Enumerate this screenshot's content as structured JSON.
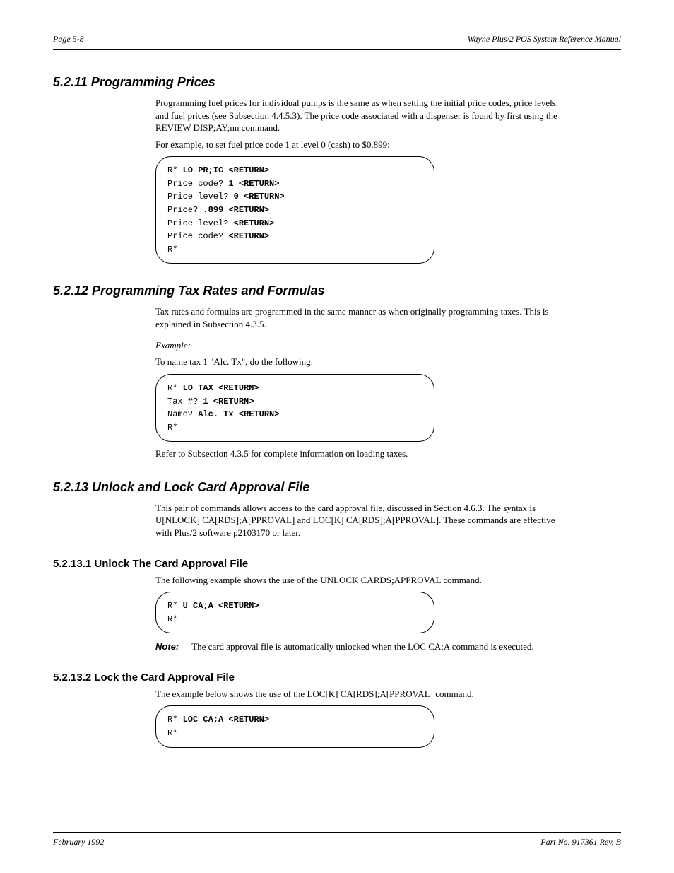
{
  "header": {
    "page_label": "Page 5-8",
    "title": "Wayne Plus/2 POS System Reference Manual"
  },
  "section1": {
    "heading": "5.2.11   Programming Prices",
    "para1": "Programming fuel prices for individual pumps is the same as when setting the initial price codes, price levels, and fuel prices (see Subsection 4.4.5.3). The price code associated with a dispenser is found by first using the REVIEW DISP;AY;nn command.",
    "para2": "For example, to set fuel price code 1 at level 0 (cash) to $0.899:",
    "terminal_lines": [
      {
        "prompt": "R* ",
        "input": "LO PR;IC <RETURN>"
      },
      {
        "prompt": "Price code? ",
        "input": "1 <RETURN>"
      },
      {
        "prompt": "Price level? ",
        "input": "0 <RETURN>"
      },
      {
        "prompt": "Price? ",
        "input": ".899 <RETURN>"
      },
      {
        "prompt": "Price level? ",
        "input": "<RETURN>"
      },
      {
        "prompt": "Price code? ",
        "input": "<RETURN>"
      },
      {
        "prompt": "R*",
        "input": ""
      }
    ]
  },
  "section2": {
    "heading": "5.2.12   Programming Tax Rates and Formulas",
    "para1": "Tax rates and formulas are programmed in the same manner as when originally programming taxes. This is explained in Subsection 4.3.5.",
    "example_label": "Example:",
    "para2": "To name tax 1 \"Alc. Tx\", do the following:",
    "terminal_lines": [
      {
        "prompt": "R* ",
        "input": "LO TAX <RETURN>"
      },
      {
        "prompt": "Tax #? ",
        "input": "1 <RETURN>"
      },
      {
        "prompt": "Name? ",
        "input": "Alc. Tx <RETURN>"
      },
      {
        "prompt": "R*",
        "input": ""
      }
    ],
    "para3": "Refer to Subsection 4.3.5 for complete information on loading taxes."
  },
  "section3": {
    "heading": "5.2.13   Unlock and Lock Card Approval File",
    "para1": "This pair of commands allows access to the card approval file, discussed in Section 4.6.3. The syntax is U[NLOCK] CA[RDS];A[PPROVAL] and LOC[K] CA[RDS];A[PPROVAL]. These commands are effective with Plus/2 software p2103170 or later.",
    "sub1": {
      "heading": "5.2.13.1   Unlock The Card Approval File",
      "para": "The following example shows the use of the UNLOCK CARDS;APPROVAL command.",
      "terminal_lines": [
        {
          "prompt": "R* ",
          "input": "U CA;A <RETURN>"
        },
        {
          "prompt": "R*",
          "input": ""
        }
      ],
      "note": "The card approval file is automatically unlocked when the LOC CA;A command is executed."
    },
    "sub2": {
      "heading": "5.2.13.2   Lock the Card Approval File",
      "para": "The example below shows the use of the LOC[K] CA[RDS];A[PPROVAL] command.",
      "terminal_lines": [
        {
          "prompt": "R* ",
          "input": "LOC CA;A <RETURN>"
        },
        {
          "prompt": "R*",
          "input": ""
        }
      ]
    }
  },
  "labels": {
    "note": "Note:"
  },
  "footer": {
    "date": "February 1992",
    "part": "Part No. 917361 Rev. B"
  }
}
